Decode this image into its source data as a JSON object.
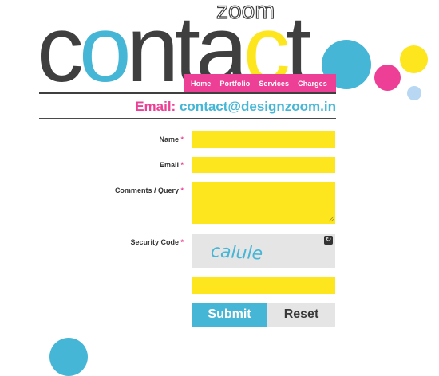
{
  "brand": {
    "logo_word": "contact",
    "logo_sub": "zoom",
    "colors": {
      "dark": "#3f3f3f",
      "cyan": "#45b6d6",
      "yellow": "#fde61e",
      "pink": "#ee3f96",
      "light_blue": "#b7d7f3"
    }
  },
  "nav": {
    "items": [
      "Home",
      "Portfolio",
      "Services",
      "Charges"
    ]
  },
  "contact": {
    "email_label": "Email:",
    "email_address": "contact@designzoom.in"
  },
  "form": {
    "name_label": "Name",
    "email_label": "Email",
    "comments_label": "Comments / Query",
    "security_label": "Security Code",
    "required_marker": "*",
    "name_value": "",
    "email_value": "",
    "comments_value": "",
    "security_value": "",
    "captcha_text": "calule",
    "refresh_icon": "refresh-icon"
  },
  "buttons": {
    "submit": "Submit",
    "reset": "Reset"
  }
}
